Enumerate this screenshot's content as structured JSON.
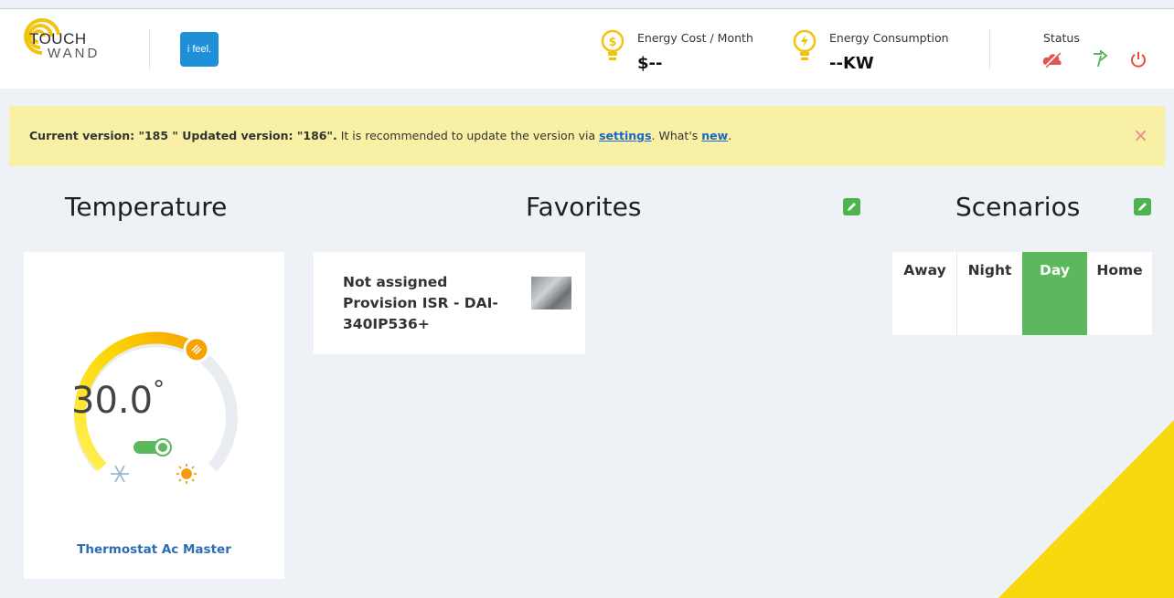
{
  "header": {
    "logo": {
      "top": "TOUCH",
      "bottom": "WAND",
      "icon": "touchwand-logo-icon"
    },
    "ifeel": {
      "label": "i feel."
    },
    "energy_cost": {
      "label": "Energy Cost / Month",
      "value": "$--",
      "icon": "dollar-bulb-icon"
    },
    "energy_consumption": {
      "label": "Energy Consumption",
      "value": "--KW",
      "icon": "lightning-bulb-icon"
    },
    "status": {
      "label": "Status",
      "icons": [
        "cloud-disconnected-icon",
        "arrow-icon",
        "power-icon"
      ]
    }
  },
  "banner": {
    "part1": "Current version: \"185 \" Updated version: \"186\".",
    "part2": " It is recommended to update the version via ",
    "settings_link": "settings",
    "part3": ". What's ",
    "new_link": "new",
    "part4": ".",
    "close": "×"
  },
  "sections": {
    "temperature": "Temperature",
    "favorites": "Favorites",
    "scenarios": "Scenarios"
  },
  "thermostat": {
    "value": "30.0",
    "degree": "°",
    "name": "Thermostat Ac Master",
    "level": 0.62,
    "colors": {
      "warm": "#f5a300",
      "cool": "#fff25a",
      "track": "#e9edf1"
    }
  },
  "favorite": {
    "line1": "Not assigned",
    "line2": "Provision ISR - DAI-",
    "line3": "340IP536+"
  },
  "scenarios": [
    {
      "label": "Away",
      "active": false
    },
    {
      "label": "Night",
      "active": false
    },
    {
      "label": "Day",
      "active": true
    },
    {
      "label": "Home",
      "active": false
    }
  ],
  "colors": {
    "accent_green": "#5cb85c",
    "banner_bg": "#f8f0a5",
    "link": "#1a66c9",
    "corner": "#f7d90f"
  }
}
